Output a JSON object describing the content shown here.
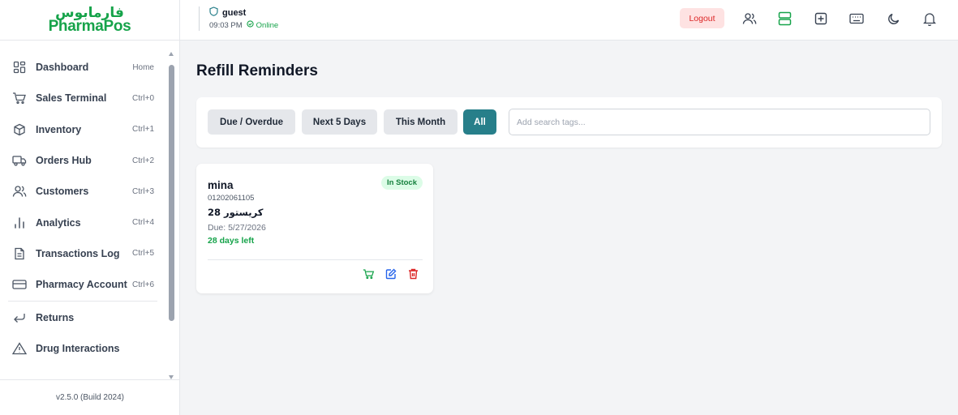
{
  "brand": {
    "logo_arabic": "فارمابوس",
    "logo_english": "PharmaPos",
    "accent": "#16a34a",
    "primary": "#277f8a"
  },
  "sidebar": {
    "items": [
      {
        "label": "Dashboard",
        "shortcut": "Home",
        "icon": "dashboard-grid-icon"
      },
      {
        "label": "Sales Terminal",
        "shortcut": "Ctrl+0",
        "icon": "cart-icon"
      },
      {
        "label": "Inventory",
        "shortcut": "Ctrl+1",
        "icon": "box-icon"
      },
      {
        "label": "Orders Hub",
        "shortcut": "Ctrl+2",
        "icon": "truck-icon"
      },
      {
        "label": "Customers",
        "shortcut": "Ctrl+3",
        "icon": "users-icon"
      },
      {
        "label": "Analytics",
        "shortcut": "Ctrl+4",
        "icon": "bar-chart-icon"
      },
      {
        "label": "Transactions Log",
        "shortcut": "Ctrl+5",
        "icon": "file-text-icon"
      },
      {
        "label": "Pharmacy Account",
        "shortcut": "Ctrl+6",
        "icon": "credit-card-icon"
      },
      {
        "label": "Returns",
        "shortcut": "",
        "icon": "return-arrow-icon"
      },
      {
        "label": "Drug Interactions",
        "shortcut": "",
        "icon": "warning-triangle-icon"
      }
    ],
    "version": "v2.5.0 (Build 2024)"
  },
  "header": {
    "user": "guest",
    "time": "09:03 PM",
    "status": "Online",
    "logout_label": "Logout",
    "icons": [
      "users-icon",
      "layout-icon",
      "plus-square-icon",
      "keyboard-icon",
      "moon-icon",
      "bell-icon"
    ]
  },
  "main": {
    "title": "Refill Reminders",
    "filters": [
      "Due / Overdue",
      "Next 5 Days",
      "This Month",
      "All"
    ],
    "active_filter": "All",
    "search_placeholder": "Add search tags...",
    "cards": [
      {
        "name": "mina",
        "phone": "01202061105",
        "drug": "كريستور 28",
        "due": "Due: 5/27/2026",
        "days_left": "28 days left",
        "badge": "In Stock"
      }
    ]
  }
}
